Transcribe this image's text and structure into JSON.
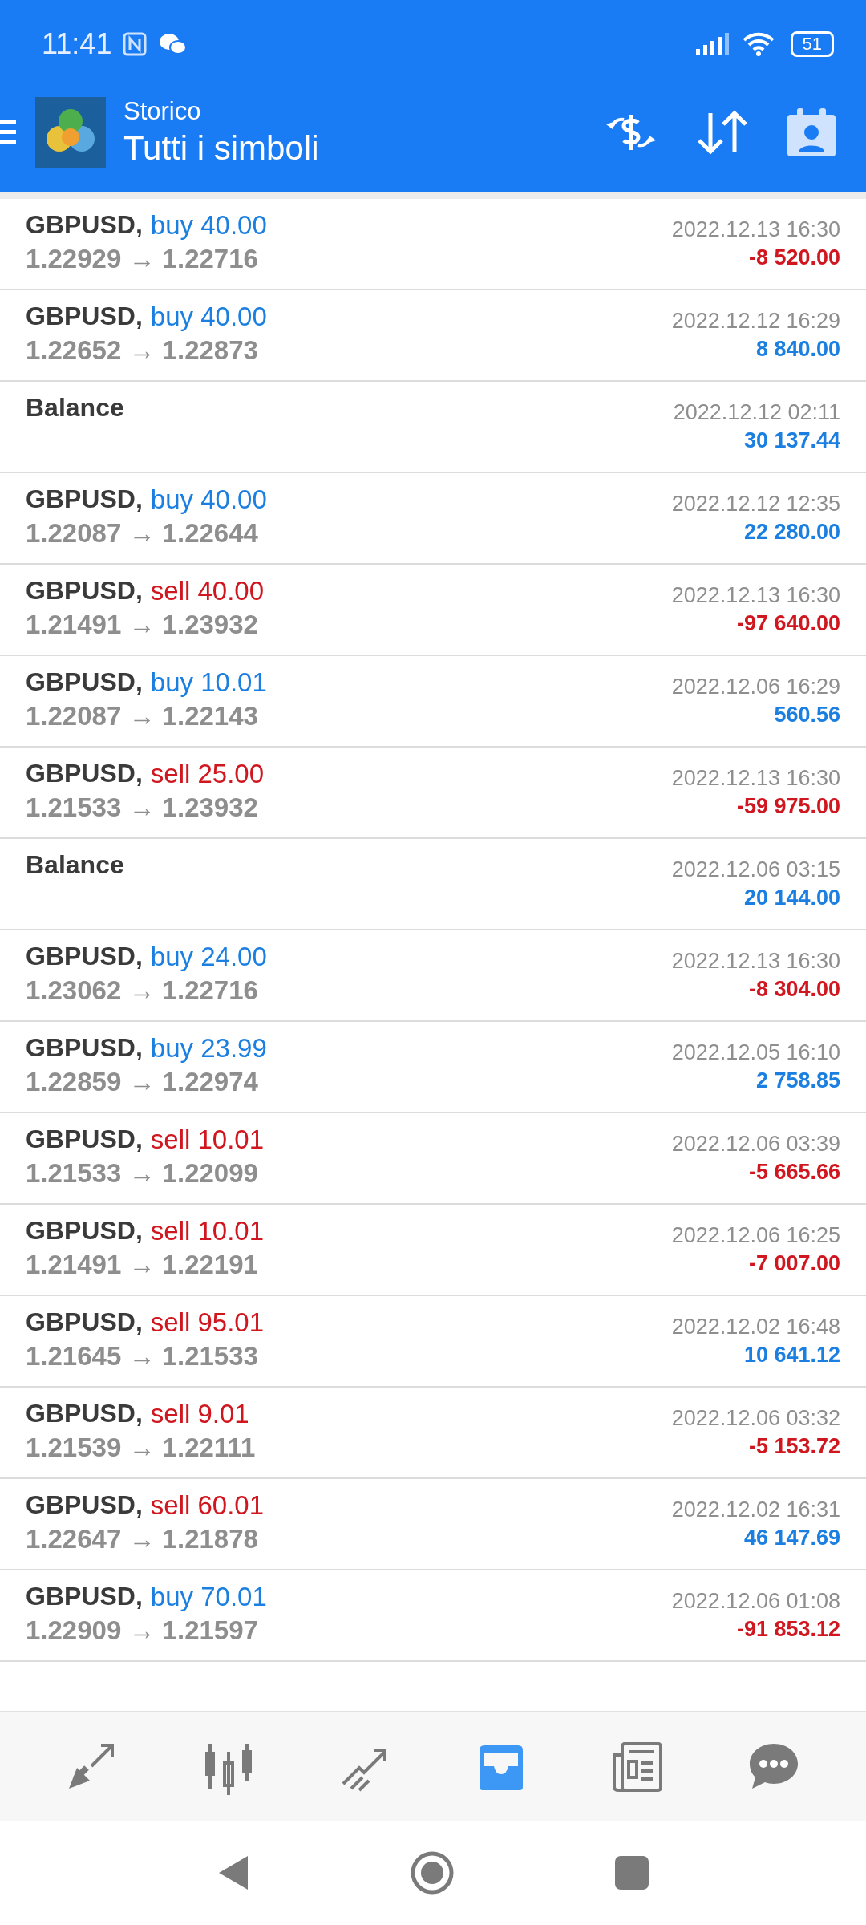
{
  "status_bar": {
    "time": "11:41",
    "battery": "51"
  },
  "header": {
    "subtitle": "Storico",
    "title": "Tutti i simboli"
  },
  "rows": [
    {
      "kind": "buy",
      "symbol": "GBPUSD,",
      "action": "buy 40.00",
      "prices": "1.22929 → 1.22716",
      "date": "2022.12.13 16:30",
      "profit": "-8 520.00",
      "loss": true
    },
    {
      "kind": "buy",
      "symbol": "GBPUSD,",
      "action": "buy 40.00",
      "prices": "1.22652 → 1.22873",
      "date": "2022.12.12 16:29",
      "profit": "8 840.00",
      "loss": false
    },
    {
      "kind": "balance",
      "symbol": "Balance",
      "date": "2022.12.12 02:11",
      "profit": "30 137.44",
      "loss": false
    },
    {
      "kind": "buy",
      "symbol": "GBPUSD,",
      "action": "buy 40.00",
      "prices": "1.22087 → 1.22644",
      "date": "2022.12.12 12:35",
      "profit": "22 280.00",
      "loss": false
    },
    {
      "kind": "sell",
      "symbol": "GBPUSD,",
      "action": "sell 40.00",
      "prices": "1.21491 → 1.23932",
      "date": "2022.12.13 16:30",
      "profit": "-97 640.00",
      "loss": true
    },
    {
      "kind": "buy",
      "symbol": "GBPUSD,",
      "action": "buy 10.01",
      "prices": "1.22087 → 1.22143",
      "date": "2022.12.06 16:29",
      "profit": "560.56",
      "loss": false
    },
    {
      "kind": "sell",
      "symbol": "GBPUSD,",
      "action": "sell 25.00",
      "prices": "1.21533 → 1.23932",
      "date": "2022.12.13 16:30",
      "profit": "-59 975.00",
      "loss": true
    },
    {
      "kind": "balance",
      "symbol": "Balance",
      "date": "2022.12.06 03:15",
      "profit": "20 144.00",
      "loss": false
    },
    {
      "kind": "buy",
      "symbol": "GBPUSD,",
      "action": "buy 24.00",
      "prices": "1.23062 → 1.22716",
      "date": "2022.12.13 16:30",
      "profit": "-8 304.00",
      "loss": true
    },
    {
      "kind": "buy",
      "symbol": "GBPUSD,",
      "action": "buy 23.99",
      "prices": "1.22859 → 1.22974",
      "date": "2022.12.05 16:10",
      "profit": "2 758.85",
      "loss": false
    },
    {
      "kind": "sell",
      "symbol": "GBPUSD,",
      "action": "sell 10.01",
      "prices": "1.21533 → 1.22099",
      "date": "2022.12.06 03:39",
      "profit": "-5 665.66",
      "loss": true
    },
    {
      "kind": "sell",
      "symbol": "GBPUSD,",
      "action": "sell 10.01",
      "prices": "1.21491 → 1.22191",
      "date": "2022.12.06 16:25",
      "profit": "-7 007.00",
      "loss": true
    },
    {
      "kind": "sell",
      "symbol": "GBPUSD,",
      "action": "sell 95.01",
      "prices": "1.21645 → 1.21533",
      "date": "2022.12.02 16:48",
      "profit": "10 641.12",
      "loss": false
    },
    {
      "kind": "sell",
      "symbol": "GBPUSD,",
      "action": "sell 9.01",
      "prices": "1.21539 → 1.22111",
      "date": "2022.12.06 03:32",
      "profit": "-5 153.72",
      "loss": true
    },
    {
      "kind": "sell",
      "symbol": "GBPUSD,",
      "action": "sell 60.01",
      "prices": "1.22647 → 1.21878",
      "date": "2022.12.02 16:31",
      "profit": "46 147.69",
      "loss": false
    },
    {
      "kind": "buy",
      "symbol": "GBPUSD,",
      "action": "buy 70.01",
      "prices": "1.22909 → 1.21597",
      "date": "2022.12.06 01:08",
      "profit": "-91 853.12",
      "loss": true
    }
  ],
  "bottom_nav": [
    {
      "kind": "quotes",
      "selected": false
    },
    {
      "kind": "chart",
      "selected": false
    },
    {
      "kind": "trade",
      "selected": false
    },
    {
      "kind": "history",
      "selected": true
    },
    {
      "kind": "news",
      "selected": false
    },
    {
      "kind": "chat",
      "selected": false
    }
  ]
}
